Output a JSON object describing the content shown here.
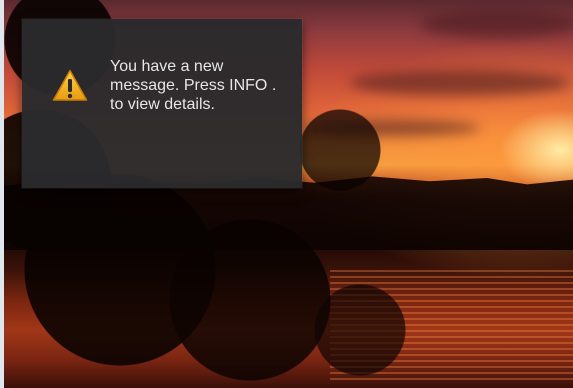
{
  "notification": {
    "message": "You have a new\nmessage. Press INFO  .\nto view details.",
    "icon": "warning-icon"
  },
  "colors": {
    "panel_bg": "#2a2a2c",
    "text": "#e6e6e6",
    "warning_yellow": "#f2b21c"
  }
}
